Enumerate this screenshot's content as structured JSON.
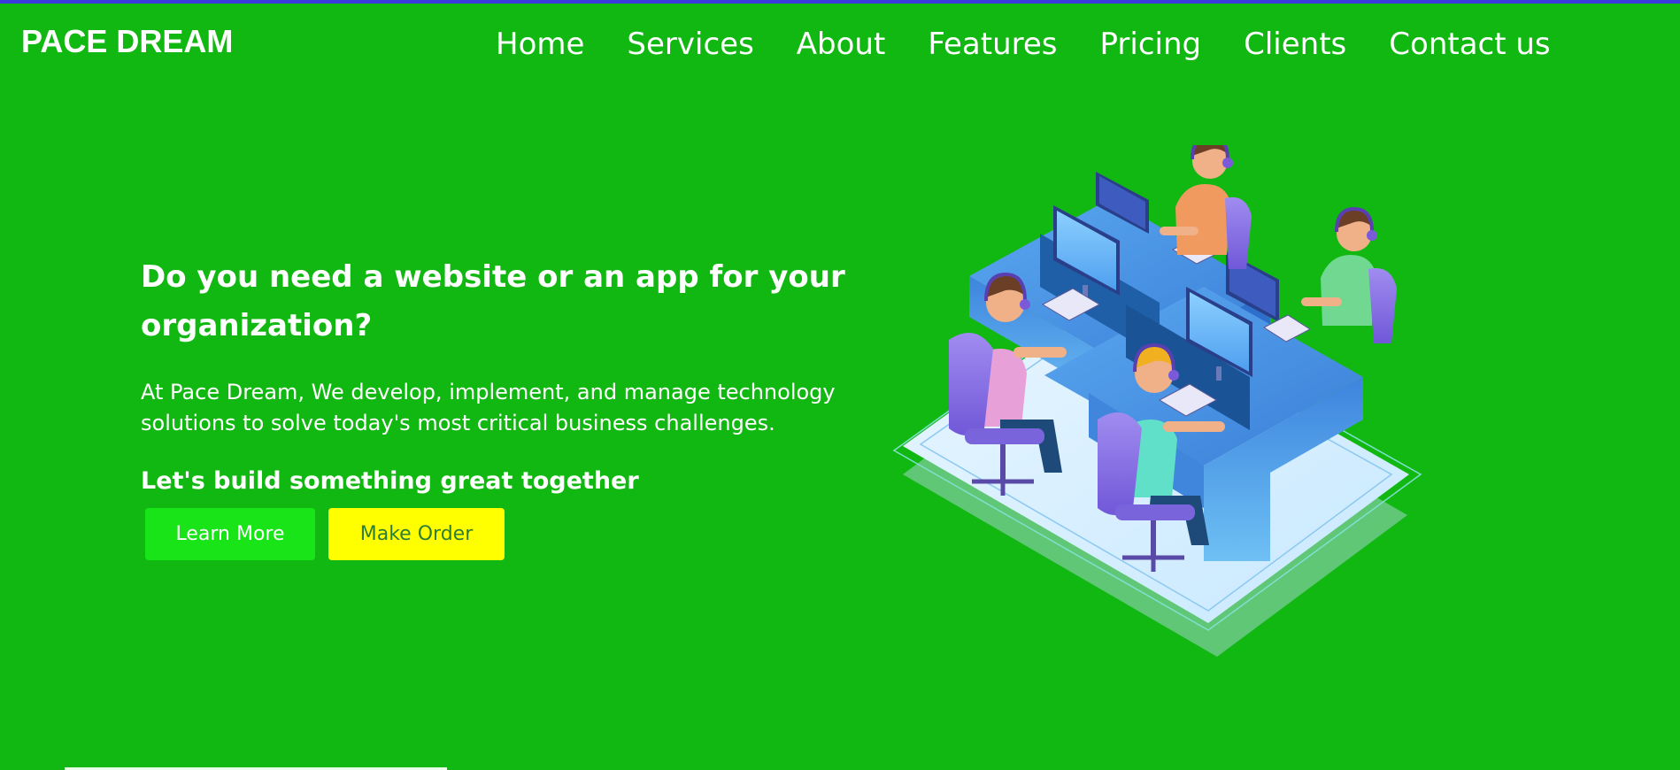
{
  "header": {
    "brand": "PACE DREAM",
    "nav": [
      {
        "label": "Home"
      },
      {
        "label": "Services"
      },
      {
        "label": "About"
      },
      {
        "label": "Features"
      },
      {
        "label": "Pricing"
      },
      {
        "label": "Clients"
      },
      {
        "label": "Contact us"
      }
    ]
  },
  "hero": {
    "title": "Do you need a website or an app for your organization?",
    "description": "At Pace Dream, We develop, implement, and manage technology solutions to solve today's most critical business challenges.",
    "cta_text": "Let's build something great together",
    "learn_more_label": "Learn More",
    "make_order_label": "Make Order"
  },
  "colors": {
    "background": "#12b812",
    "top_border": "#3a3adf",
    "learn_more_bg": "#18e418",
    "make_order_bg": "#ffff00",
    "make_order_text": "#2e7d32"
  },
  "illustration": {
    "icon": "isometric-office-team-illustration"
  }
}
